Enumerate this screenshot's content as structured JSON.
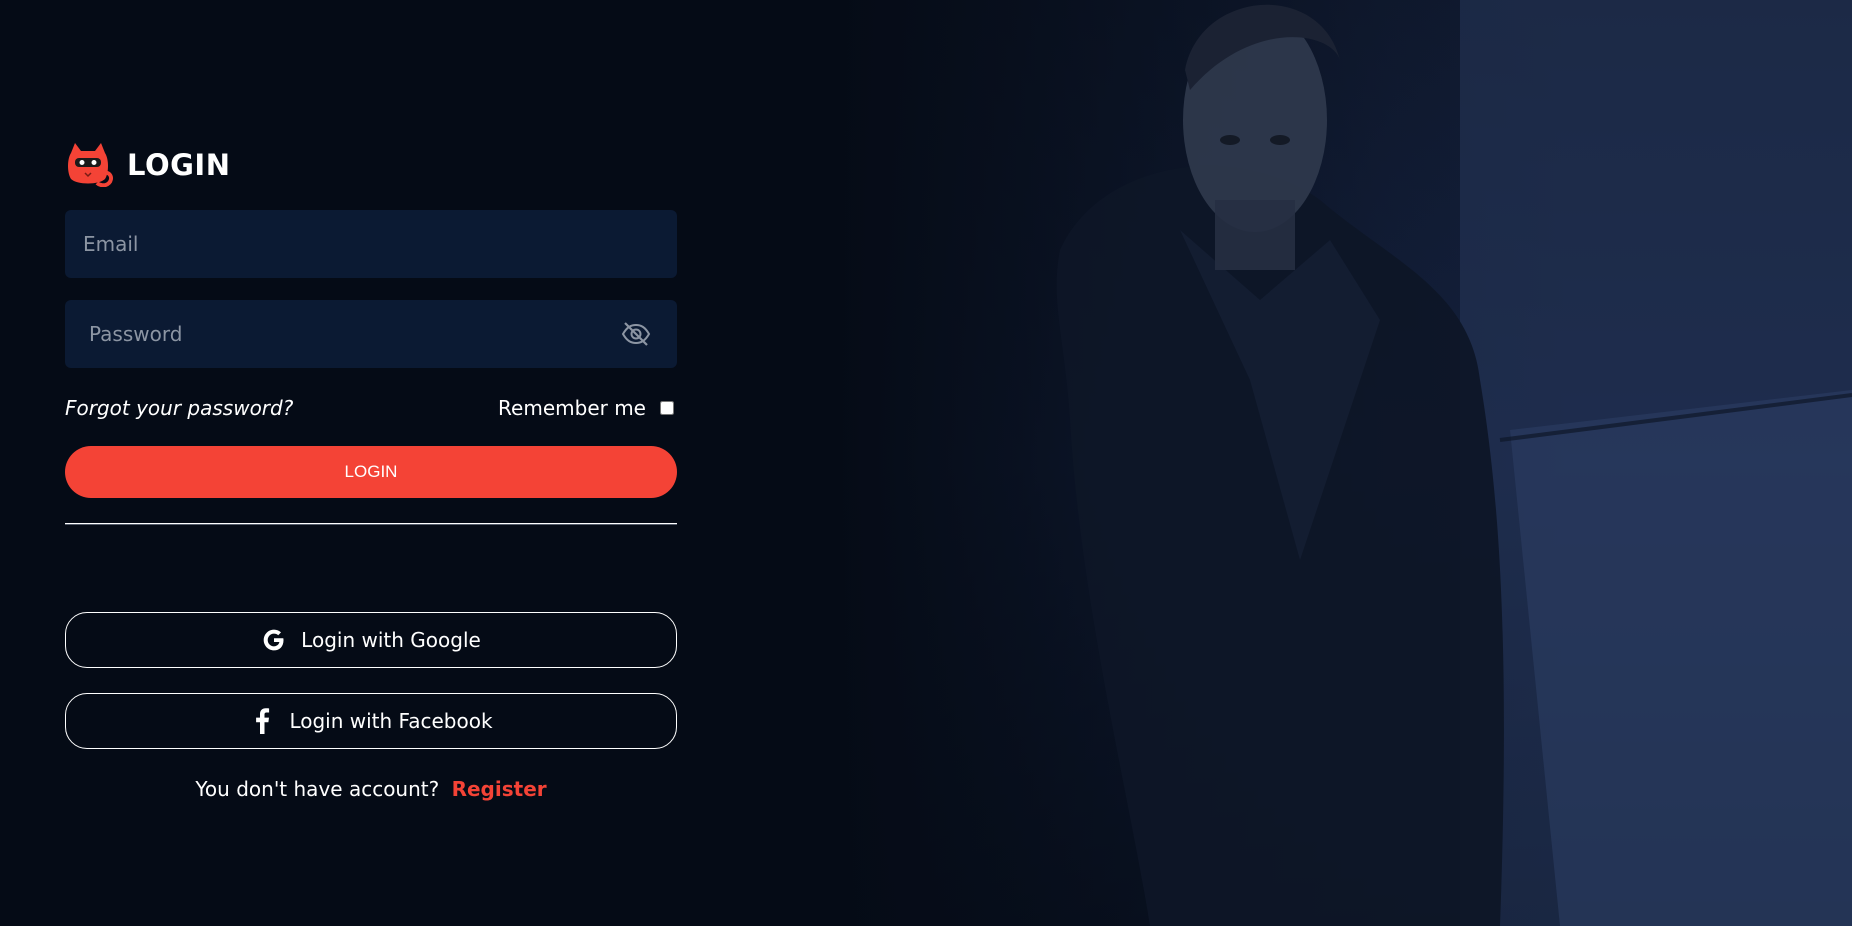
{
  "brand": {
    "title": "LOGIN",
    "logo_icon": "cat-mascot-icon",
    "accent_color": "#f44336"
  },
  "form": {
    "email_placeholder": "Email",
    "password_placeholder": "Password",
    "password_toggle_icon": "eye-off-icon",
    "forgot_label": "Forgot your password?",
    "remember_label": "Remember me",
    "remember_checked": false,
    "submit_label": "LOGIN"
  },
  "social": {
    "google_label": "Login with Google",
    "google_icon": "google-icon",
    "facebook_label": "Login with Facebook",
    "facebook_icon": "facebook-icon"
  },
  "footer": {
    "prompt": "You don't have account?",
    "register_label": "Register"
  }
}
